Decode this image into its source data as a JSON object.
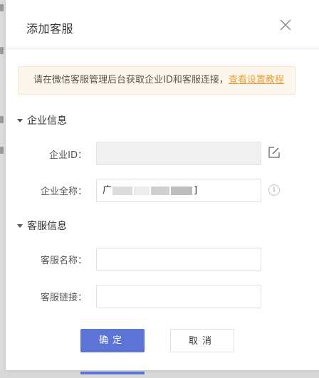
{
  "dialog": {
    "title": "添加客服",
    "notice_text": "请在微信客服管理后台获取企业ID和客服连接，",
    "notice_link": "查看设置教程",
    "section_enterprise": "企业信息",
    "section_service": "客服信息",
    "fields": {
      "corp_id_label": "企业ID：",
      "corp_id_value": "",
      "corp_name_label": "企业全称：",
      "corp_name_value": "广",
      "corp_name_tail": "]",
      "service_name_label": "客服名称：",
      "service_name_value": "",
      "service_link_label": "客服链接：",
      "service_link_value": ""
    },
    "buttons": {
      "confirm": "确定",
      "cancel": "取消"
    }
  },
  "icons": {
    "close": "close-icon",
    "edit": "edit-icon",
    "info": "info-icon",
    "info_glyph": "i",
    "caret": "caret-down-icon"
  },
  "colors": {
    "primary": "#5b74d6",
    "link": "#e6a23c",
    "notice_bg": "#fdf6ec"
  }
}
